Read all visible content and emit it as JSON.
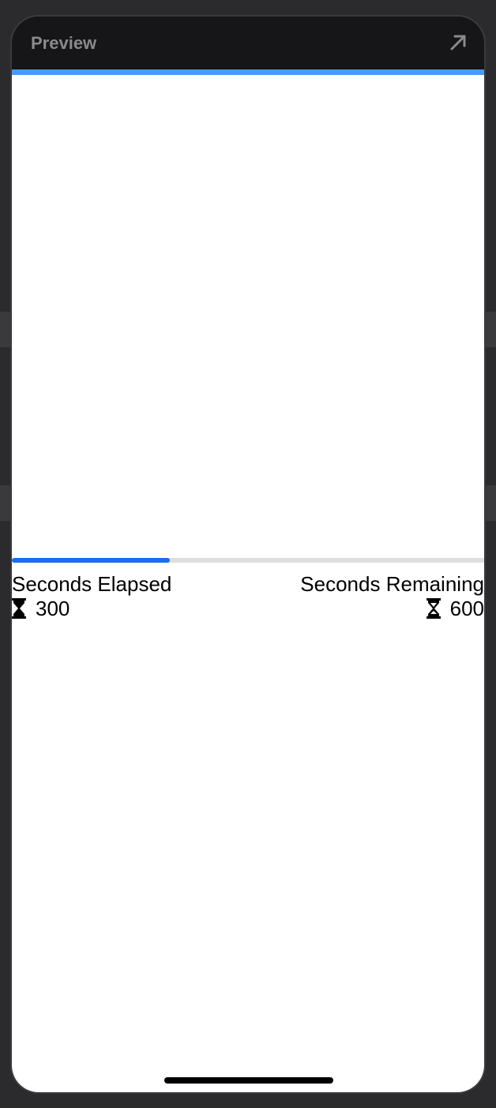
{
  "window": {
    "title": "Preview",
    "expand_icon": "arrow-up-right-icon"
  },
  "colors": {
    "accent": "#4a9af5",
    "progress_fill": "#1a6cf0",
    "progress_track": "#dedede"
  },
  "timer": {
    "progress_fraction": 0.333,
    "elapsed_label": "Seconds Elapsed",
    "elapsed_value": "300",
    "remaining_label": "Seconds Remaining",
    "remaining_value": "600",
    "icon": "hourglass-icon"
  }
}
